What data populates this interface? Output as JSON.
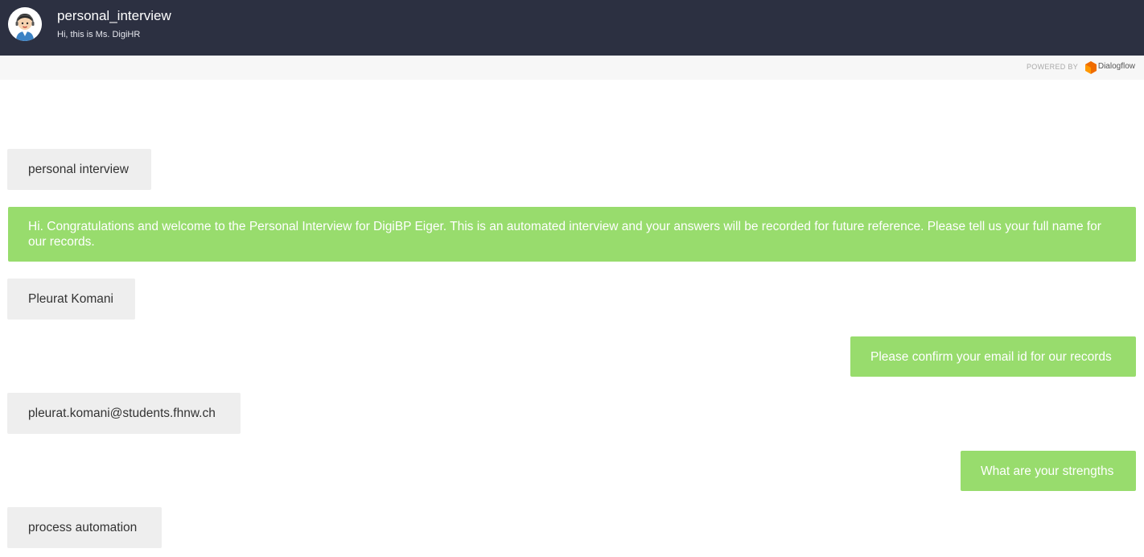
{
  "header": {
    "title": "personal_interview",
    "subtitle": "Hi, this is Ms. DigiHR"
  },
  "powered": {
    "label": "POWERED BY",
    "brand": "Dialogflow"
  },
  "colors": {
    "header_bg": "#2c3041",
    "bot_bubble": "#98dc6d",
    "user_bubble": "#eeeeee",
    "dialogflow_orange": "#ef6c00"
  },
  "messages": [
    {
      "sender": "user",
      "text": "personal interview"
    },
    {
      "sender": "bot",
      "text": "Hi. Congratulations and welcome to the Personal Interview for DigiBP Eiger. This is an automated interview and your answers will be recorded for future reference. Please tell us your full name for our records."
    },
    {
      "sender": "user",
      "text": "Pleurat Komani"
    },
    {
      "sender": "bot",
      "text": "Please confirm your email id for our records"
    },
    {
      "sender": "user",
      "text": "pleurat.komani@students.fhnw.ch"
    },
    {
      "sender": "bot",
      "text": "What are your strengths"
    },
    {
      "sender": "user",
      "text": "process automation"
    }
  ]
}
